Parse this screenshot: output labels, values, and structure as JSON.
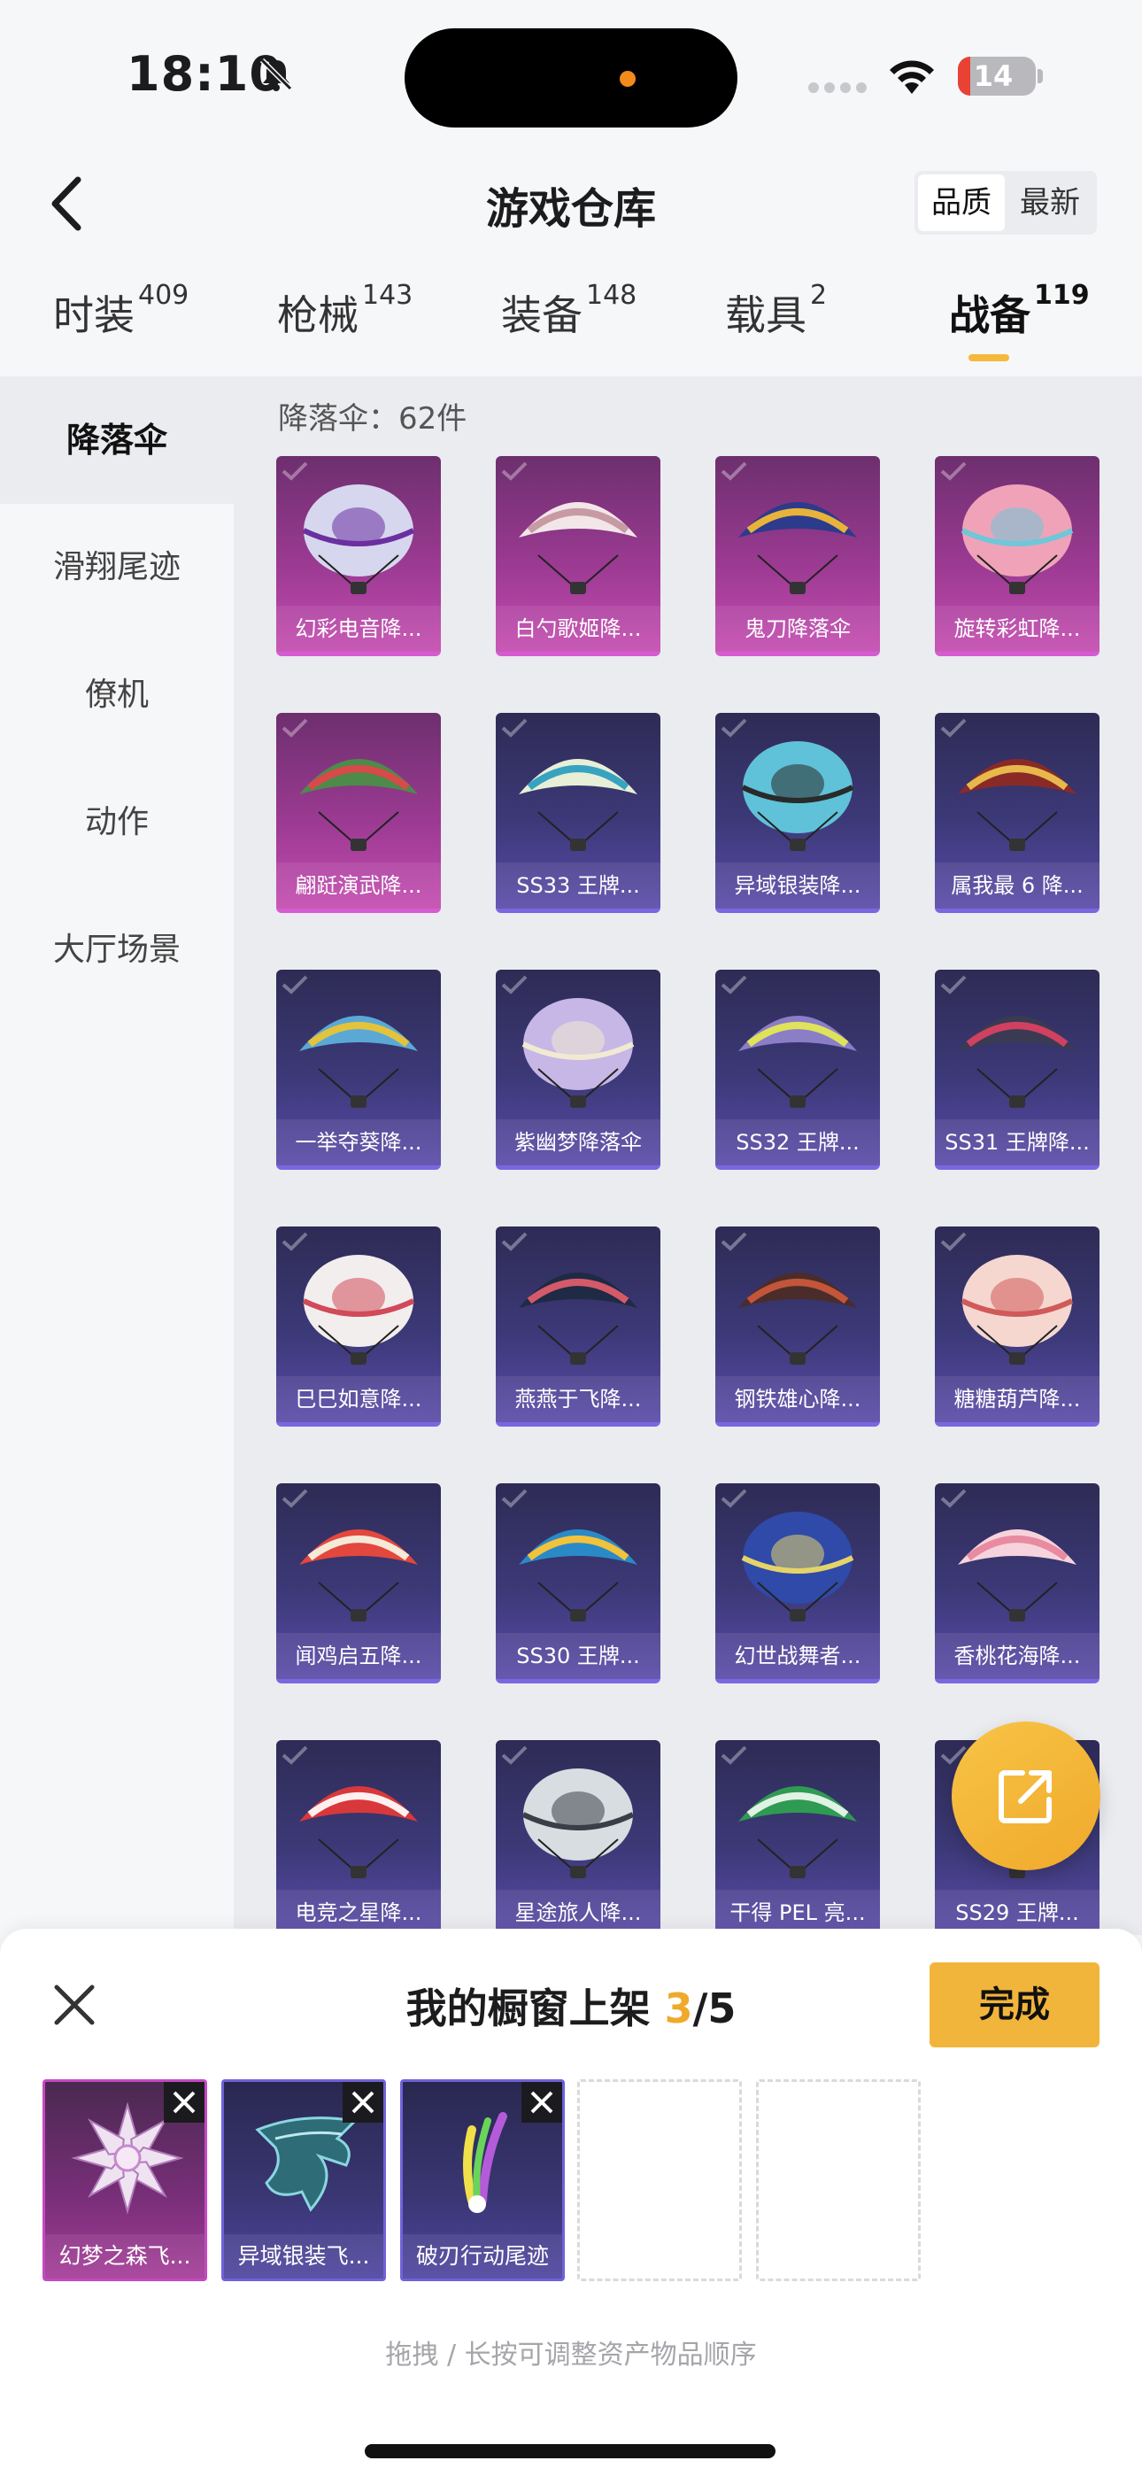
{
  "status_bar": {
    "time": "18:10",
    "battery": "14"
  },
  "nav": {
    "title": "游戏仓库",
    "sort_options": [
      "品质",
      "最新"
    ]
  },
  "tabs": [
    {
      "label": "时装",
      "count": "409"
    },
    {
      "label": "枪械",
      "count": "143"
    },
    {
      "label": "装备",
      "count": "148"
    },
    {
      "label": "载具",
      "count": "2"
    },
    {
      "label": "战备",
      "count": "119"
    }
  ],
  "active_tab": "战备",
  "sidebar": {
    "items": [
      "降落伞",
      "滑翔尾迹",
      "僚机",
      "动作",
      "大厅场景"
    ]
  },
  "section": {
    "count_label": "降落伞：62件"
  },
  "items": [
    {
      "name": "幻彩电音降...",
      "rarity": "pink",
      "colors": [
        "#d6d6ef",
        "#6b2fa0"
      ]
    },
    {
      "name": "白勺歌姬降...",
      "rarity": "pink",
      "colors": [
        "#f2e6e8",
        "#c79aa4"
      ]
    },
    {
      "name": "鬼刀降落伞",
      "rarity": "pink",
      "colors": [
        "#2c3b8c",
        "#e8b33a"
      ]
    },
    {
      "name": "旋转彩虹降...",
      "rarity": "pink",
      "colors": [
        "#f0a3b8",
        "#6fc7d8"
      ]
    },
    {
      "name": "翩跹演武降...",
      "rarity": "pink",
      "colors": [
        "#4e8a4a",
        "#d84a4a"
      ]
    },
    {
      "name": "SS33 王牌...",
      "rarity": "blue",
      "colors": [
        "#e7efd7",
        "#37a3c0"
      ]
    },
    {
      "name": "异域银装降...",
      "rarity": "blue",
      "colors": [
        "#5fc2d8",
        "#2a2a2a"
      ]
    },
    {
      "name": "属我最 6 降...",
      "rarity": "blue",
      "colors": [
        "#8a2a26",
        "#e7b84c"
      ]
    },
    {
      "name": "一举夺葵降...",
      "rarity": "blue",
      "colors": [
        "#5aa8d6",
        "#e3c23c"
      ]
    },
    {
      "name": "紫幽梦降落伞",
      "rarity": "blue",
      "colors": [
        "#c6b7e6",
        "#f2e9d2"
      ]
    },
    {
      "name": "SS32 王牌...",
      "rarity": "blue",
      "colors": [
        "#8a7ec7",
        "#dfe35a"
      ]
    },
    {
      "name": "SS31 王牌降...",
      "rarity": "blue",
      "colors": [
        "#3a3a52",
        "#d04060"
      ]
    },
    {
      "name": "巳巳如意降...",
      "rarity": "blue",
      "colors": [
        "#f3eeee",
        "#d04a5a"
      ]
    },
    {
      "name": "燕燕于飞降...",
      "rarity": "blue",
      "colors": [
        "#1f2a44",
        "#d45a6a"
      ]
    },
    {
      "name": "钢铁雄心降...",
      "rarity": "blue",
      "colors": [
        "#4a2c2a",
        "#c2553a"
      ]
    },
    {
      "name": "糖糖葫芦降...",
      "rarity": "blue",
      "colors": [
        "#f5d7d0",
        "#d05a5a"
      ]
    },
    {
      "name": "闻鸡启五降...",
      "rarity": "blue",
      "colors": [
        "#e3473e",
        "#f5e9d7"
      ]
    },
    {
      "name": "SS30 王牌...",
      "rarity": "blue",
      "colors": [
        "#2a8ac7",
        "#f2c23c"
      ]
    },
    {
      "name": "幻世战舞者...",
      "rarity": "blue",
      "colors": [
        "#2f4aa8",
        "#e5d36a"
      ]
    },
    {
      "name": "香桃花海降...",
      "rarity": "blue",
      "colors": [
        "#f6d3dc",
        "#e88aa0"
      ]
    },
    {
      "name": "电竞之星降...",
      "rarity": "blue",
      "colors": [
        "#d9383a",
        "#fff0f0"
      ]
    },
    {
      "name": "星途旅人降...",
      "rarity": "blue",
      "colors": [
        "#d8dde2",
        "#3a3f47"
      ]
    },
    {
      "name": "干得 PEL 亮...",
      "rarity": "blue",
      "colors": [
        "#2f9a52",
        "#e0f2e4"
      ]
    },
    {
      "name": "SS29 王牌...",
      "rarity": "blue",
      "colors": [
        "#e9eef3",
        "#6a7a8a"
      ]
    }
  ],
  "panel": {
    "title": "我的橱窗上架",
    "current": "3",
    "separator": "/",
    "total": "5",
    "done_label": "完成",
    "hint": "拖拽 / 长按可调整资产物品顺序",
    "shelf": [
      {
        "name": "幻梦之森飞...",
        "rarity": "pink"
      },
      {
        "name": "异域银装飞...",
        "rarity": "blue"
      },
      {
        "name": "破刃行动尾迹",
        "rarity": "blue"
      }
    ]
  }
}
